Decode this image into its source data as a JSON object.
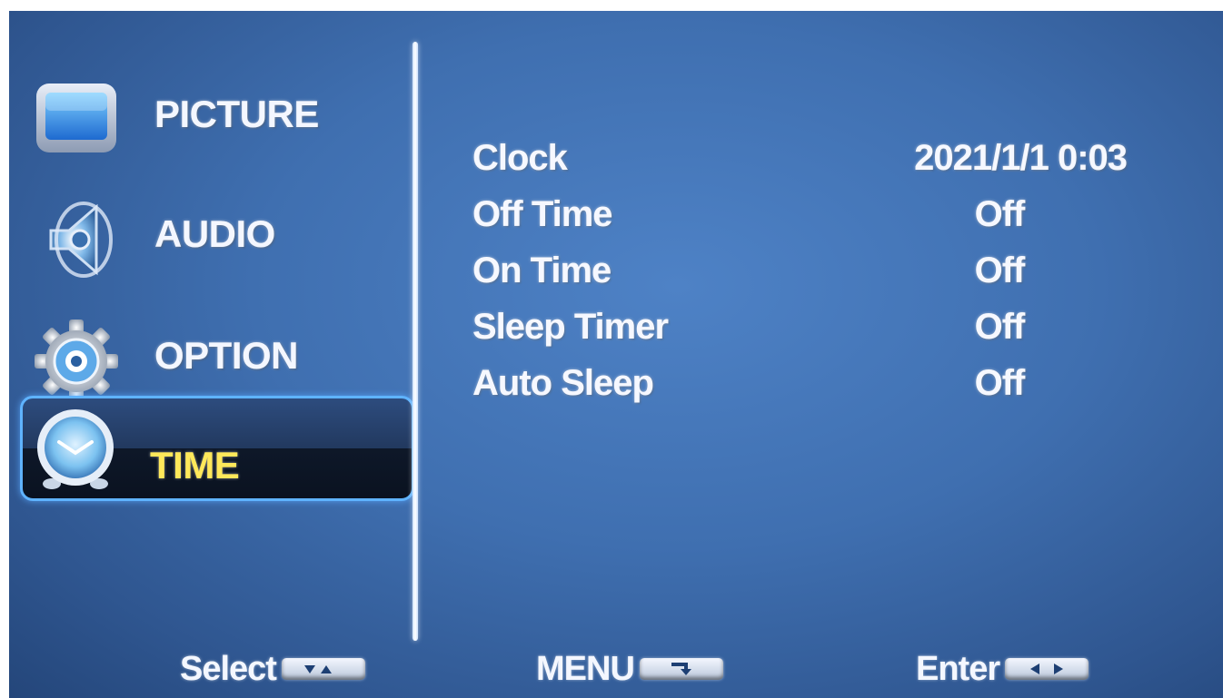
{
  "sidebar": {
    "items": [
      {
        "label": "PICTURE",
        "icon": "monitor-icon",
        "selected": false
      },
      {
        "label": "AUDIO",
        "icon": "speaker-icon",
        "selected": false
      },
      {
        "label": "OPTION",
        "icon": "gear-icon",
        "selected": false
      },
      {
        "label": "TIME",
        "icon": "clock-icon",
        "selected": true
      }
    ]
  },
  "settings": {
    "rows": [
      {
        "name": "Clock",
        "value": "2021/1/1 0:03"
      },
      {
        "name": "Off Time",
        "value": "Off"
      },
      {
        "name": "On Time",
        "value": "Off"
      },
      {
        "name": "Sleep Timer",
        "value": "Off"
      },
      {
        "name": "Auto Sleep",
        "value": "Off"
      }
    ]
  },
  "footer": {
    "select_label": "Select",
    "menu_label": "MENU",
    "enter_label": "Enter"
  },
  "colors": {
    "background": "#3f6fb0",
    "selected_text": "#ffe85a",
    "highlight_border": "#5fb3ff",
    "text": "#f4f7ff"
  }
}
